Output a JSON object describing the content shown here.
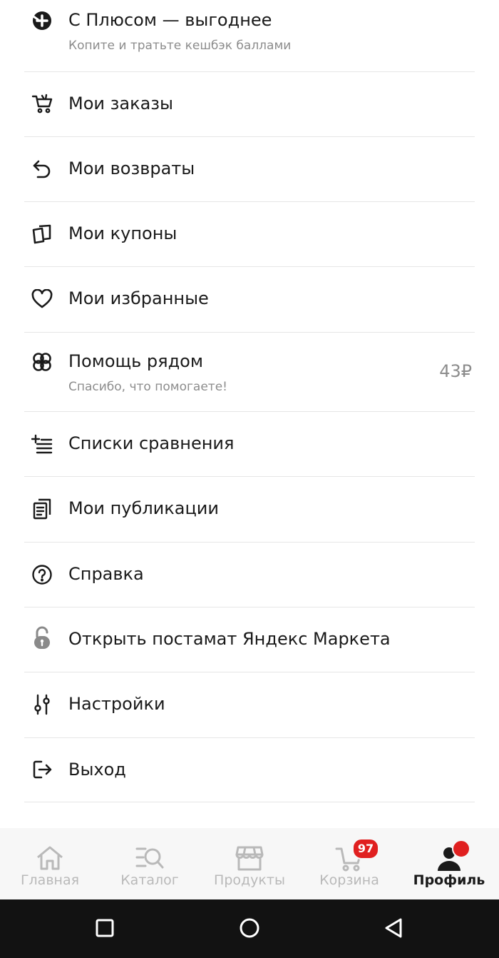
{
  "menu": {
    "items": [
      {
        "id": "plus",
        "title": "С Плюсом — выгоднее",
        "subtitle": "Копите и тратьте кешбэк баллами",
        "icon": "plus-circle-icon"
      },
      {
        "id": "orders",
        "title": "Мои заказы",
        "icon": "cart-icon"
      },
      {
        "id": "returns",
        "title": "Мои возвраты",
        "icon": "return-arrow-icon"
      },
      {
        "id": "coupons",
        "title": "Мои купоны",
        "icon": "coupons-icon"
      },
      {
        "id": "favorites",
        "title": "Мои избранные",
        "icon": "heart-icon"
      },
      {
        "id": "help-nearby",
        "title": "Помощь рядом",
        "subtitle": "Спасибо, что помогаете!",
        "value": "43₽",
        "icon": "help-nearby-icon"
      },
      {
        "id": "compare",
        "title": "Списки сравнения",
        "icon": "list-add-icon"
      },
      {
        "id": "publications",
        "title": "Мои публикации",
        "icon": "documents-icon"
      },
      {
        "id": "help",
        "title": "Справка",
        "icon": "question-circle-icon"
      },
      {
        "id": "postamat",
        "title": "Открыть постамат Яндекс Маркета",
        "icon": "padlock-open-icon"
      },
      {
        "id": "settings",
        "title": "Настройки",
        "icon": "sliders-icon"
      },
      {
        "id": "logout",
        "title": "Выход",
        "icon": "logout-icon"
      }
    ]
  },
  "tabbar": {
    "tabs": [
      {
        "label": "Главная",
        "icon": "home-icon"
      },
      {
        "label": "Каталог",
        "icon": "catalog-search-icon"
      },
      {
        "label": "Продукты",
        "icon": "store-icon"
      },
      {
        "label": "Корзина",
        "icon": "cart-tab-icon",
        "badge": "97"
      },
      {
        "label": "Профиль",
        "icon": "profile-icon",
        "active": true
      }
    ]
  },
  "colors": {
    "accent_red": "#e02020",
    "inactive_tab": "#b9b9b9",
    "divider": "#e6e6e6",
    "system_nav": "#121212"
  }
}
